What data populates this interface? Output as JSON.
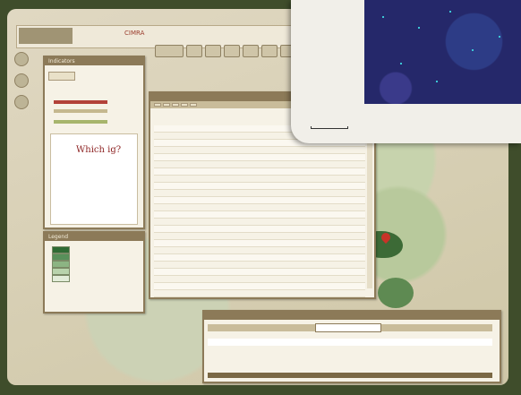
{
  "app": {
    "logo_title": "CIMRA",
    "logo_subtitle": "",
    "credits": ""
  },
  "toolbar": {
    "tools": [
      "",
      "",
      "",
      "",
      "",
      "",
      ""
    ]
  },
  "indicators_panel": {
    "title": "Indicators",
    "tab": "",
    "which_title": "Which ig?",
    "which_text": ""
  },
  "legend_panel": {
    "title": "Legend",
    "rows": [
      {
        "label": "",
        "color": "#2f6b34"
      },
      {
        "label": "",
        "color": "#58905a"
      },
      {
        "label": "",
        "color": "#8cb483"
      },
      {
        "label": "",
        "color": "#b8d3ac"
      },
      {
        "label": "",
        "color": "#e2ecd9"
      }
    ]
  },
  "table_panel": {
    "title": "",
    "tabs": [
      "",
      "",
      "",
      "",
      ""
    ],
    "rows": [
      {
        "name": "",
        "value": ""
      },
      {
        "name": "",
        "value": ""
      },
      {
        "name": "",
        "value": ""
      },
      {
        "name": "",
        "value": ""
      },
      {
        "name": "",
        "value": ""
      },
      {
        "name": "",
        "value": ""
      },
      {
        "name": "",
        "value": ""
      },
      {
        "name": "",
        "value": ""
      },
      {
        "name": "",
        "value": ""
      },
      {
        "name": "",
        "value": ""
      },
      {
        "name": "",
        "value": ""
      },
      {
        "name": "",
        "value": ""
      },
      {
        "name": "",
        "value": ""
      },
      {
        "name": "",
        "value": ""
      },
      {
        "name": "",
        "value": ""
      },
      {
        "name": "",
        "value": ""
      },
      {
        "name": "",
        "value": ""
      },
      {
        "name": "",
        "value": ""
      },
      {
        "name": "",
        "value": ""
      },
      {
        "name": "",
        "value": ""
      },
      {
        "name": "",
        "value": ""
      },
      {
        "name": "",
        "value": ""
      },
      {
        "name": "",
        "value": ""
      },
      {
        "name": "",
        "value": ""
      }
    ]
  },
  "details_panel": {
    "title": "",
    "select_value": "",
    "row_text": ""
  },
  "inset": {
    "scale_label": ""
  },
  "colors": {
    "panel_border": "#8c7a58",
    "marker": "#c83328",
    "inset_dots": "#3bc6d6"
  }
}
